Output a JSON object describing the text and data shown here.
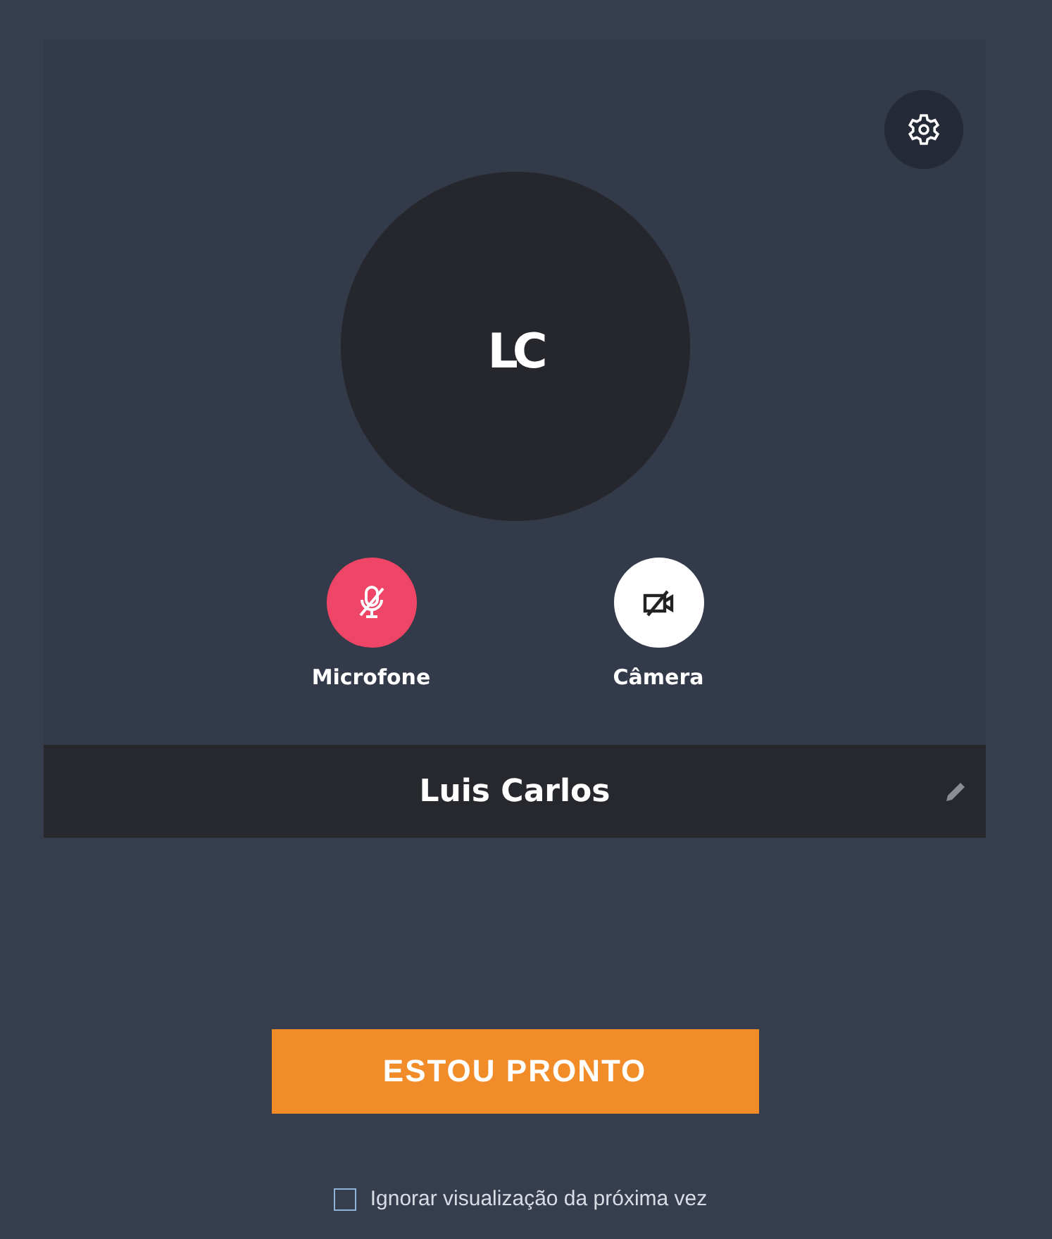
{
  "preview": {
    "avatar": {
      "initials": "LC"
    },
    "controls": [
      {
        "kind": "microphone",
        "label": "Microfone",
        "on": false
      },
      {
        "kind": "camera",
        "label": "Câmera",
        "on": false
      }
    ],
    "name": "Luis Carlos"
  },
  "ready_button": "ESTOU PRONTO",
  "skip_preview": {
    "label": "Ignorar visualização da próxima vez",
    "checked": false
  }
}
